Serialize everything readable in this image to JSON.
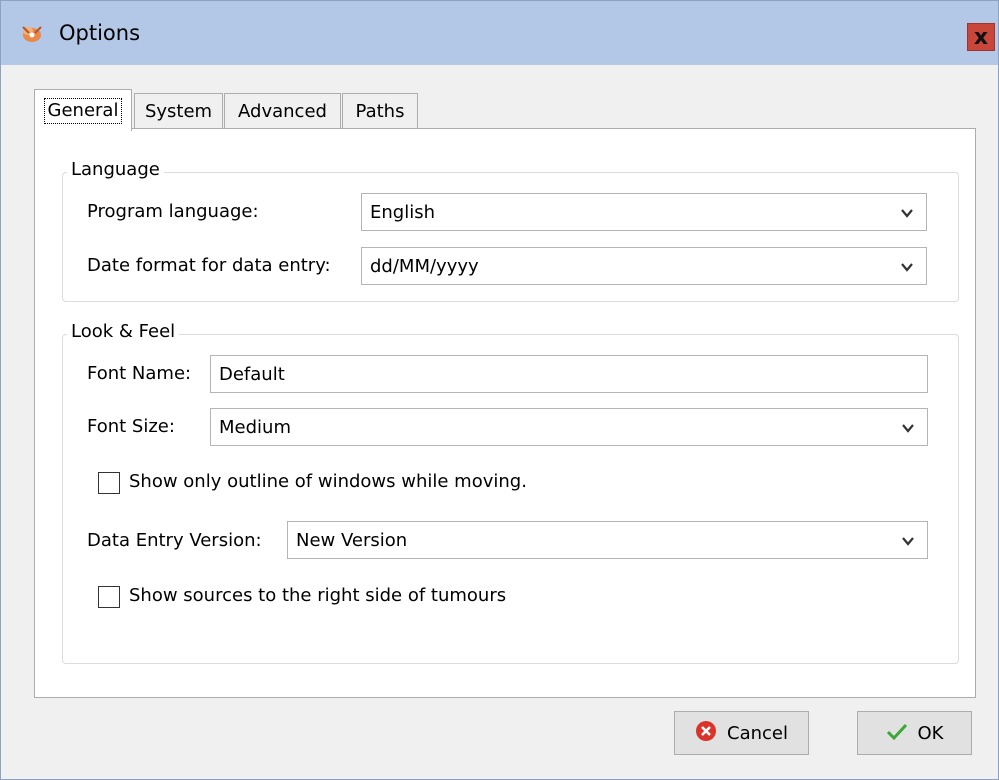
{
  "window": {
    "title": "Options",
    "close_label": "x"
  },
  "tabs": [
    {
      "label": "General"
    },
    {
      "label": "System"
    },
    {
      "label": "Advanced"
    },
    {
      "label": "Paths"
    }
  ],
  "language_group": {
    "title": "Language",
    "program_language_label": "Program language:",
    "program_language_value": "English",
    "date_format_label": "Date format for data entry:",
    "date_format_value": "dd/MM/yyyy"
  },
  "look_group": {
    "title": "Look & Feel",
    "font_name_label": "Font Name:",
    "font_name_value": "Default",
    "font_size_label": "Font Size:",
    "font_size_value": "Medium",
    "outline_checkbox_label": "Show only outline of windows while moving.",
    "data_entry_version_label": "Data Entry Version:",
    "data_entry_version_value": "New Version",
    "sources_checkbox_label": "Show sources to the right side of tumours"
  },
  "buttons": {
    "cancel": "Cancel",
    "ok": "OK"
  },
  "colors": {
    "titlebar": "#b3c8e6",
    "close": "#c9463b",
    "cancel_icon": "#d9332b",
    "ok_icon": "#3aa834"
  }
}
